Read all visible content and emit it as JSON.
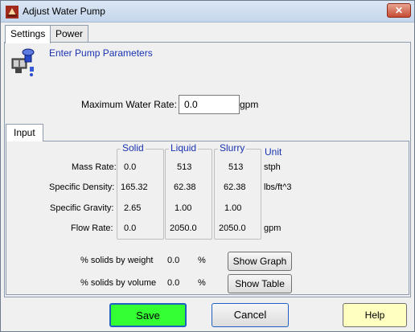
{
  "window": {
    "title": "Adjust Water Pump",
    "close_glyph": "✕"
  },
  "tabs": [
    {
      "label": "Settings",
      "active": true
    },
    {
      "label": "Power",
      "active": false
    }
  ],
  "settings": {
    "heading": "Enter Pump Parameters",
    "max_water_rate": {
      "label": "Maximum Water Rate:",
      "value": "0.0",
      "unit": "gpm"
    }
  },
  "input_tab": {
    "label": "Input"
  },
  "table": {
    "columns": {
      "solid": "Solid",
      "liquid": "Liquid",
      "slurry": "Slurry",
      "unit": "Unit"
    },
    "rows": [
      {
        "label": "Mass Rate:",
        "solid": "0.0",
        "liquid": "513",
        "slurry": "513",
        "unit": "stph"
      },
      {
        "label": "Specific Density:",
        "solid": "165.32",
        "liquid": "62.38",
        "slurry": "62.38",
        "unit": "lbs/ft^3"
      },
      {
        "label": "Specific Gravity:",
        "solid": "2.65",
        "liquid": "1.00",
        "slurry": "1.00",
        "unit": ""
      },
      {
        "label": "Flow Rate:",
        "solid": "0.0",
        "liquid": "2050.0",
        "slurry": "2050.0",
        "unit": "gpm"
      }
    ]
  },
  "solids": {
    "by_weight": {
      "label": "% solids by weight",
      "value": "0.0",
      "unit": "%"
    },
    "by_volume": {
      "label": "% solids by volume",
      "value": "0.0",
      "unit": "%"
    }
  },
  "buttons": {
    "show_graph": "Show Graph",
    "show_table": "Show Table",
    "save": "Save",
    "cancel": "Cancel",
    "help": "Help"
  },
  "colors": {
    "save_green": "#33ff33",
    "help_yellow": "#ffffc0",
    "heading_blue": "#1a32b0"
  },
  "icons": {
    "app": "app-icon",
    "pump": "water-pump-icon"
  }
}
